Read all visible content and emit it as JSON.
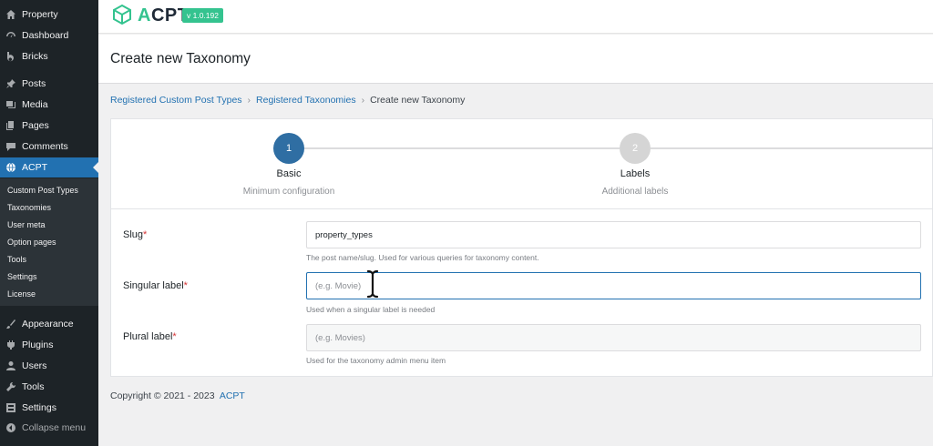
{
  "sidebar": {
    "menu": [
      {
        "label": "Property",
        "icon": "house-icon"
      },
      {
        "label": "Dashboard",
        "icon": "dashboard-gauge-icon"
      },
      {
        "label": "Bricks",
        "icon": "bricks-b-icon"
      },
      {
        "label": "Posts",
        "icon": "pushpin-icon"
      },
      {
        "label": "Media",
        "icon": "media-icon"
      },
      {
        "label": "Pages",
        "icon": "pages-icon"
      },
      {
        "label": "Comments",
        "icon": "comment-bubble-icon"
      },
      {
        "label": "ACPT",
        "icon": "globe-icon",
        "active": true
      }
    ],
    "submenu": [
      "Custom Post Types",
      "Taxonomies",
      "User meta",
      "Option pages",
      "Tools",
      "Settings",
      "License"
    ],
    "menu_bottom": [
      {
        "label": "Appearance",
        "icon": "paintbrush-icon"
      },
      {
        "label": "Plugins",
        "icon": "plug-icon"
      },
      {
        "label": "Users",
        "icon": "user-icon"
      },
      {
        "label": "Tools",
        "icon": "wrench-icon"
      },
      {
        "label": "Settings",
        "icon": "settings-icon"
      }
    ],
    "collapse_label": "Collapse menu"
  },
  "topbar": {
    "logo_first": "A",
    "logo_rest": "CPT",
    "version": "v 1.0.192"
  },
  "page_title": "Create new Taxonomy",
  "breadcrumb": {
    "items": [
      "Registered Custom Post Types",
      "Registered Taxonomies",
      "Create new Taxonomy"
    ],
    "separator": "›"
  },
  "steps": [
    {
      "number": "1",
      "title": "Basic",
      "subtitle": "Minimum configuration",
      "active": true
    },
    {
      "number": "2",
      "title": "Labels",
      "subtitle": "Additional labels",
      "active": false
    }
  ],
  "form": {
    "slug": {
      "label": "Slug",
      "required": "*",
      "value": "property_types",
      "help": "The post name/slug. Used for various queries for taxonomy content."
    },
    "singular": {
      "label": "Singular label",
      "required": "*",
      "placeholder": "(e.g. Movie)",
      "help": "Used when a singular label is needed"
    },
    "plural": {
      "label": "Plural label",
      "required": "*",
      "placeholder": "(e.g. Movies)",
      "help": "Used for the taxonomy admin menu item"
    }
  },
  "footer": {
    "copyright": "Copyright © 2021 - 2023",
    "link": "ACPT"
  },
  "colors": {
    "sidebar_bg": "#1d2327",
    "active_blue": "#2271b1",
    "brand_green": "#34c38f",
    "step_active": "#2f6ea3",
    "required_red": "#d63638"
  }
}
